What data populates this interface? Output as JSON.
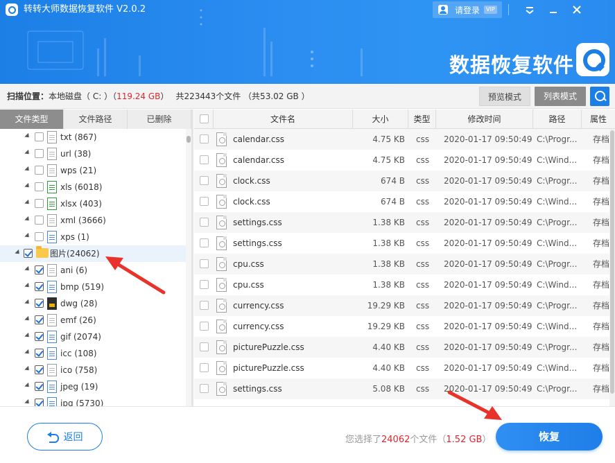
{
  "window": {
    "title": "转转大师数据恢复软件 V2.0.2",
    "login_label": "请登录",
    "vip_badge": "VIP",
    "brand_text": "数据恢复软件"
  },
  "scan": {
    "location_label": "扫描位置：",
    "disk_prefix": "本地磁盘（ C: ）（",
    "disk_size": "119.24 GB",
    "disk_suffix": "）",
    "total_prefix": "共223443个文件 （共53.02 GB ）",
    "preview_mode": "预览模式",
    "list_mode": "列表模式"
  },
  "tabs": [
    "文件类型",
    "文件路径",
    "已删除"
  ],
  "tree": [
    {
      "label": "txt (867)",
      "level": 1,
      "checked": false,
      "icon": "txt-file-icon",
      "color": "gray"
    },
    {
      "label": "url (38)",
      "level": 1,
      "checked": false,
      "icon": "url-file-icon",
      "color": "gray"
    },
    {
      "label": "wps (21)",
      "level": 1,
      "checked": false,
      "icon": "wps-file-icon",
      "color": "gray"
    },
    {
      "label": "xls (6018)",
      "level": 1,
      "checked": false,
      "icon": "excel-file-icon",
      "color": "green"
    },
    {
      "label": "xlsx (403)",
      "level": 1,
      "checked": false,
      "icon": "excel-file-icon",
      "color": "green"
    },
    {
      "label": "xml (3666)",
      "level": 1,
      "checked": false,
      "icon": "xml-file-icon",
      "color": "gray"
    },
    {
      "label": "xps (1)",
      "level": 1,
      "checked": false,
      "icon": "xps-file-icon",
      "color": "blue"
    },
    {
      "label": "图片(24062)",
      "level": 0,
      "checked": true,
      "icon": "folder-icon",
      "color": "folder"
    },
    {
      "label": "ani (6)",
      "level": 1,
      "checked": true,
      "icon": "ani-file-icon",
      "color": "gray"
    },
    {
      "label": "bmp (519)",
      "level": 1,
      "checked": true,
      "icon": "image-file-icon",
      "color": "blue"
    },
    {
      "label": "dwg (28)",
      "level": 1,
      "checked": true,
      "icon": "dwg-file-icon",
      "color": "dark"
    },
    {
      "label": "emf (26)",
      "level": 1,
      "checked": true,
      "icon": "emf-file-icon",
      "color": "gray"
    },
    {
      "label": "gif (2074)",
      "level": 1,
      "checked": true,
      "icon": "image-file-icon",
      "color": "blue"
    },
    {
      "label": "icc (108)",
      "level": 1,
      "checked": true,
      "icon": "icc-file-icon",
      "color": "blue"
    },
    {
      "label": "ico (758)",
      "level": 1,
      "checked": true,
      "icon": "ico-file-icon",
      "color": "gray"
    },
    {
      "label": "jpeg (19)",
      "level": 1,
      "checked": true,
      "icon": "image-file-icon",
      "color": "blue"
    },
    {
      "label": "jpg (5730)",
      "level": 1,
      "checked": true,
      "icon": "image-file-icon",
      "color": "blue"
    }
  ],
  "table": {
    "columns": [
      "文件名",
      "大小",
      "类型",
      "修改时间",
      "路径",
      "属性"
    ],
    "rows": [
      {
        "name": "calendar.css",
        "size": "4.75 KB",
        "type": "css",
        "time": "2020-01-17 09:50:49",
        "path": "C:\\Progr...",
        "attr": "存档"
      },
      {
        "name": "calendar.css",
        "size": "4.75 KB",
        "type": "css",
        "time": "2020-01-17 09:50:49",
        "path": "C:\\Wind...",
        "attr": "存档"
      },
      {
        "name": "clock.css",
        "size": "674 B",
        "type": "css",
        "time": "2020-01-17 09:50:49",
        "path": "C:\\Progr...",
        "attr": "存档"
      },
      {
        "name": "clock.css",
        "size": "674 B",
        "type": "css",
        "time": "2020-01-17 09:50:49",
        "path": "C:\\Wind...",
        "attr": "存档"
      },
      {
        "name": "settings.css",
        "size": "1.38 KB",
        "type": "css",
        "time": "2020-01-17 09:50:49",
        "path": "C:\\Progr...",
        "attr": "存档"
      },
      {
        "name": "settings.css",
        "size": "1.38 KB",
        "type": "css",
        "time": "2020-01-17 09:50:49",
        "path": "C:\\Wind...",
        "attr": "存档"
      },
      {
        "name": "cpu.css",
        "size": "1.38 KB",
        "type": "css",
        "time": "2020-01-17 09:50:49",
        "path": "C:\\Progr...",
        "attr": "存档"
      },
      {
        "name": "cpu.css",
        "size": "1.38 KB",
        "type": "css",
        "time": "2020-01-17 09:50:49",
        "path": "C:\\Wind...",
        "attr": "存档"
      },
      {
        "name": "currency.css",
        "size": "19.29 KB",
        "type": "css",
        "time": "2020-01-17 09:50:49",
        "path": "C:\\Progr...",
        "attr": "存档"
      },
      {
        "name": "currency.css",
        "size": "19.29 KB",
        "type": "css",
        "time": "2020-01-17 09:50:49",
        "path": "C:\\Wind...",
        "attr": "存档"
      },
      {
        "name": "picturePuzzle.css",
        "size": "4.40 KB",
        "type": "css",
        "time": "2020-01-17 09:50:49",
        "path": "C:\\Progr...",
        "attr": "存档"
      },
      {
        "name": "picturePuzzle.css",
        "size": "4.40 KB",
        "type": "css",
        "time": "2020-01-17 09:50:49",
        "path": "C:\\Wind...",
        "attr": "存档"
      },
      {
        "name": "settings.css",
        "size": "5.08 KB",
        "type": "css",
        "time": "2020-01-17 09:50:49",
        "path": "C:\\Progr...",
        "attr": "存档"
      }
    ]
  },
  "bottom": {
    "back_label": "返回",
    "selected_prefix": "您选择了",
    "selected_count": "24062",
    "selected_mid": "个文件（",
    "selected_size": "1.52 GB",
    "selected_suffix": "）",
    "recover_label": "恢复"
  },
  "colors": {
    "accent": "#1c7fe6",
    "highlight_red": "#e0262b",
    "annotation_arrow": "#e8332b"
  }
}
